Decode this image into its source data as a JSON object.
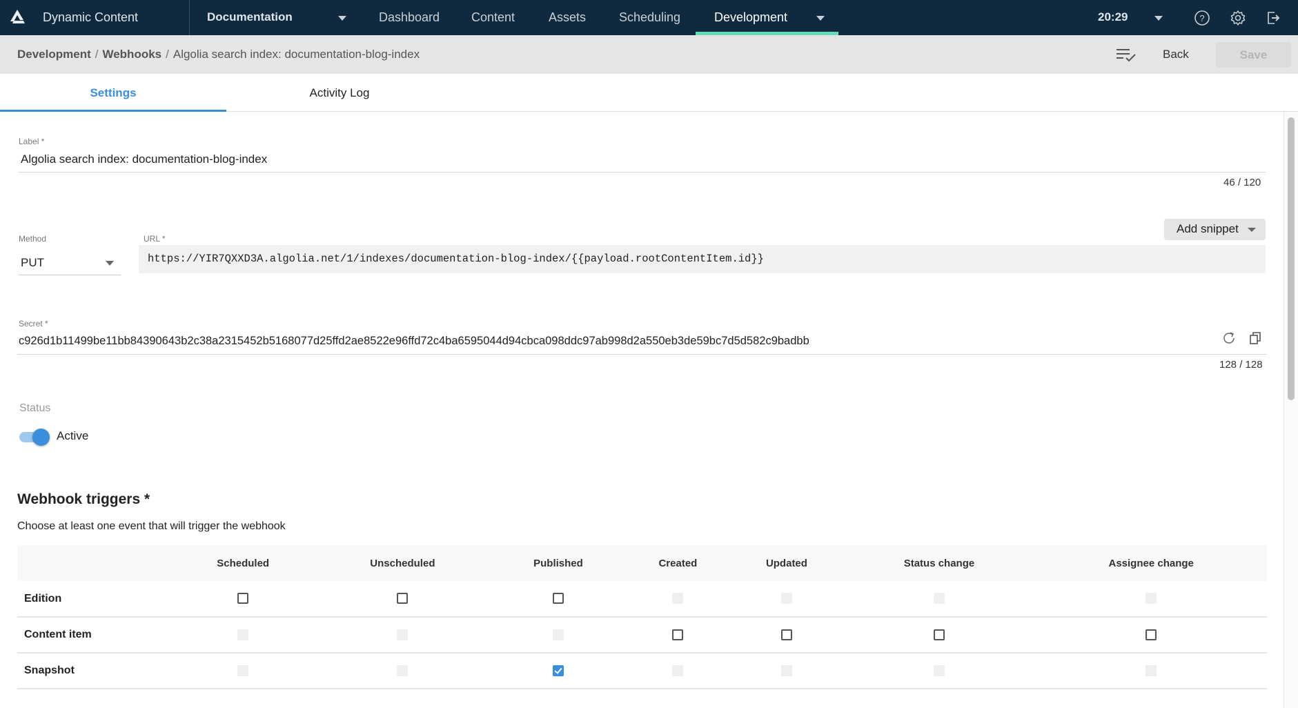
{
  "topnav": {
    "app_title": "Dynamic Content",
    "hub": "Documentation",
    "items": [
      {
        "label": "Dashboard",
        "active": false
      },
      {
        "label": "Content",
        "active": false
      },
      {
        "label": "Assets",
        "active": false
      },
      {
        "label": "Scheduling",
        "active": false
      },
      {
        "label": "Development",
        "active": true
      }
    ],
    "time": "20:29",
    "icons": [
      "help-icon",
      "settings-icon",
      "logout-icon"
    ],
    "accent_color": "#64dcb8",
    "background_color": "#0f2a3f"
  },
  "breadcrumb": {
    "items": [
      "Development",
      "Webhooks",
      "Algolia search index: documentation-blog-index"
    ],
    "back_label": "Back",
    "save_label": "Save"
  },
  "tabs": [
    {
      "label": "Settings",
      "active": true
    },
    {
      "label": "Activity Log",
      "active": false
    }
  ],
  "form": {
    "label_field": {
      "label": "Label *",
      "value": "Algolia search index: documentation-blog-index",
      "counter": "46 / 120"
    },
    "method_field": {
      "label": "Method",
      "value": "PUT"
    },
    "url_field": {
      "label": "URL *",
      "value": "https://YIR7QXXD3A.algolia.net/1/indexes/documentation-blog-index/{{payload.rootContentItem.id}}",
      "add_snippet_label": "Add snippet"
    },
    "secret_field": {
      "label": "Secret *",
      "value": "c926d1b11499be11bb84390643b2c38a2315452b5168077d25ffd2ae8522e96ffd72c4ba6595044d94cbca098ddc97ab998d2a550eb3de59bc7d5d582c9badbb",
      "counter": "128 / 128"
    },
    "status": {
      "label": "Status",
      "toggle_label": "Active",
      "active": true
    }
  },
  "triggers": {
    "title": "Webhook triggers *",
    "subtitle": "Choose at least one event that will trigger the webhook",
    "columns": [
      "Scheduled",
      "Unscheduled",
      "Published",
      "Created",
      "Updated",
      "Status change",
      "Assignee change"
    ],
    "rows": [
      {
        "label": "Edition",
        "cells": [
          "unchecked",
          "unchecked",
          "unchecked",
          "disabled",
          "disabled",
          "disabled",
          "disabled"
        ]
      },
      {
        "label": "Content item",
        "cells": [
          "disabled",
          "disabled",
          "disabled",
          "unchecked",
          "unchecked",
          "unchecked",
          "unchecked"
        ]
      },
      {
        "label": "Snapshot",
        "cells": [
          "disabled",
          "disabled",
          "checked",
          "disabled",
          "disabled",
          "disabled",
          "disabled"
        ]
      }
    ],
    "checked_color": "#3a8fdc"
  }
}
